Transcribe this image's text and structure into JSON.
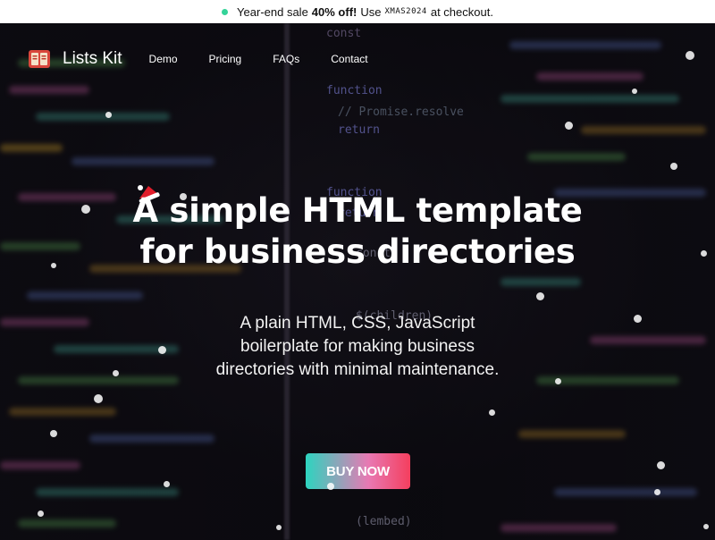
{
  "banner": {
    "prefix": "Year-end sale",
    "highlight": "40% off!",
    "use_text": "Use",
    "code": "XMAS2024",
    "suffix": "at checkout."
  },
  "nav": {
    "brand": "Lists Kit",
    "links": [
      "Demo",
      "Pricing",
      "FAQs",
      "Contact"
    ]
  },
  "hero": {
    "headline_lines": [
      "A simple HTML template",
      "for business directories"
    ],
    "subtitle_lines": [
      "A plain HTML, CSS, JavaScript",
      "boilerplate for making business",
      "directories with minimal maintenance."
    ],
    "cta_label": "BUY NOW"
  },
  "colors": {
    "accent_teal": "#2dd4bf",
    "accent_pink": "#f43f5e",
    "banner_bg": "#ffffff"
  },
  "icons": {
    "logo": "book-icon",
    "headline_decoration": "santa-hat-icon"
  }
}
